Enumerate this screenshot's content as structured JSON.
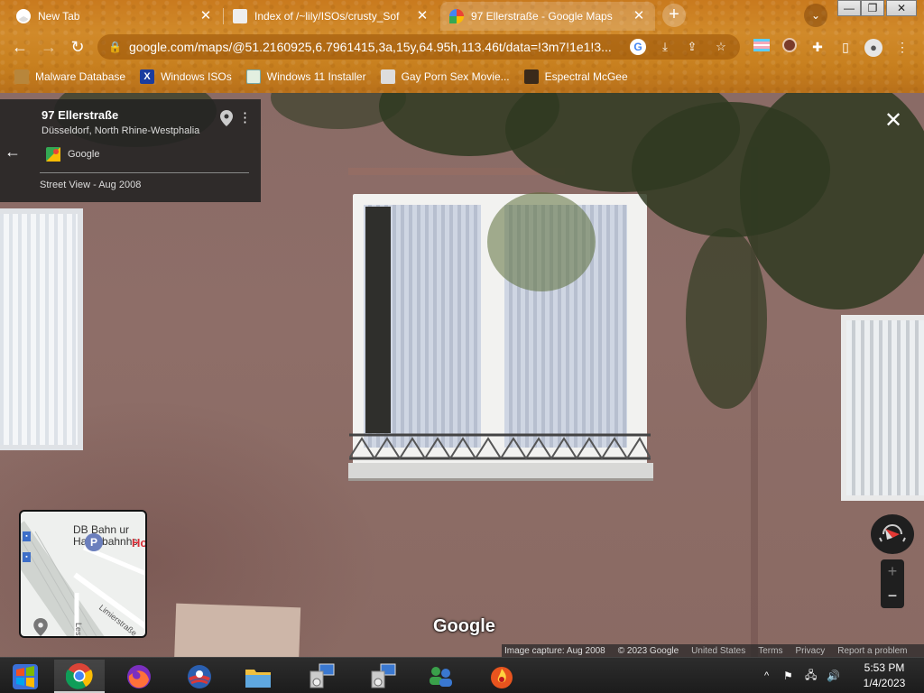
{
  "window": {
    "minimize": "—",
    "restore": "❐",
    "close": "✕"
  },
  "tabs": [
    {
      "title": "New Tab",
      "close": "✕"
    },
    {
      "title": "Index of /~lily/ISOs/crusty_Sof",
      "close": "✕"
    },
    {
      "title": "97 Ellerstraße - Google Maps",
      "close": "✕"
    }
  ],
  "tabstrip": {
    "new_tab": "+",
    "tab_search": "⌄"
  },
  "toolbar": {
    "back": "←",
    "forward": "→",
    "reload": "↻",
    "url": "google.com/maps/@51.2160925,6.7961415,3a,15y,64.95h,113.46t/data=!3m7!1e1!3...",
    "bookmark_star": "☆",
    "menu": "⋮"
  },
  "bookmarks": [
    {
      "label": "Malware Database",
      "icon": "folder-icon"
    },
    {
      "label": "Windows ISOs",
      "icon": "x-icon"
    },
    {
      "label": "Windows 11 Installer",
      "icon": "image-icon"
    },
    {
      "label": "Gay Porn Sex Movie...",
      "icon": "bookmark-icon"
    },
    {
      "label": "Espectral McGee",
      "icon": "bookmark-icon"
    }
  ],
  "street_view": {
    "title": "97 Ellerstraße",
    "subtitle": "Düsseldorf, North Rhine-Westphalia",
    "source": "Google",
    "date_label": "Street View - Aug 2008",
    "back": "←",
    "more": "⋮",
    "close": "✕",
    "watermark": "Google"
  },
  "minimap": {
    "station_label": "DB Bahn ... Hauptbahnhof",
    "station_line1": "DB Bahn ur",
    "station_line2": "Hauptbahnhc",
    "poi_label": "Ho",
    "parking": "P",
    "street1": "Limierstraße",
    "street2": "Lessi"
  },
  "controls": {
    "zoom_in": "+",
    "zoom_out": "−"
  },
  "attribution": {
    "capture": "Image capture: Aug 2008",
    "copyright": "© 2023 Google",
    "country": "United States",
    "terms": "Terms",
    "privacy": "Privacy",
    "report": "Report a problem"
  },
  "taskbar": {
    "time": "5:53 PM",
    "date": "1/4/2023",
    "tray_chevron": "^"
  },
  "colors": {
    "chrome_theme": "#c97a1e",
    "wall": "#8a6b66",
    "map_red": "#d93038"
  }
}
